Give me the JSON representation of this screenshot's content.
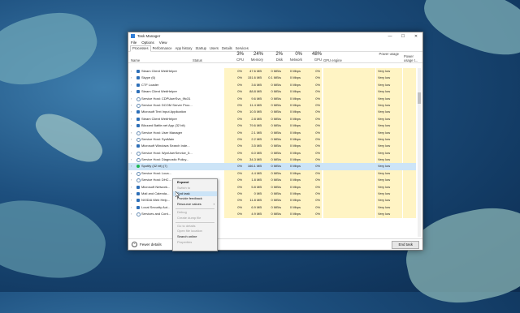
{
  "window": {
    "title": "Task Manager",
    "controls": [
      "—",
      "☐",
      "✕"
    ]
  },
  "menu": [
    "File",
    "Options",
    "View"
  ],
  "tabs": [
    "Processes",
    "Performance",
    "App history",
    "Startup",
    "Users",
    "Details",
    "Services"
  ],
  "columns": {
    "name": "Name",
    "status": "Status",
    "cpu": {
      "pct": "3%",
      "label": "CPU"
    },
    "memory": {
      "pct": "24%",
      "label": "Memory"
    },
    "disk": {
      "pct": "2%",
      "label": "Disk"
    },
    "network": {
      "pct": "0%",
      "label": "Network"
    },
    "gpu": {
      "pct": "48%",
      "label": "GPU"
    },
    "gpu_engine": "GPU engine",
    "power": "Power usage",
    "power_trend": "Power usage t..."
  },
  "rows": [
    {
      "name": "Steam Client WebHelper",
      "icon": "steam-icon",
      "cpu": "0%",
      "mem": "47.6 MB",
      "disk": "0 MB/s",
      "net": "0 Mbps",
      "gpu": "0%",
      "power": "Very low"
    },
    {
      "name": "Skype (6)",
      "icon": "skype-icon",
      "cpu": "0%",
      "mem": "151.6 MB",
      "disk": "0.1 MB/s",
      "net": "0 Mbps",
      "gpu": "0%",
      "power": "Very low"
    },
    {
      "name": "CTF Loader",
      "icon": "ctf-icon",
      "cpu": "0%",
      "mem": "3.6 MB",
      "disk": "0 MB/s",
      "net": "0 Mbps",
      "gpu": "0%",
      "power": "Very low"
    },
    {
      "name": "Steam Client WebHelper",
      "icon": "steam-icon",
      "cpu": "0%",
      "mem": "88.8 MB",
      "disk": "0 MB/s",
      "net": "0 Mbps",
      "gpu": "0%",
      "power": "Very low"
    },
    {
      "name": "Service Host: CDPUserSvc_9fc31",
      "icon": "service-gear-icon",
      "cpu": "0%",
      "mem": "9.6 MB",
      "disk": "0 MB/s",
      "net": "0 Mbps",
      "gpu": "0%",
      "power": "Very low"
    },
    {
      "name": "Service Host: DCOM Server Proc...",
      "icon": "service-gear-icon",
      "cpu": "0%",
      "mem": "11.4 MB",
      "disk": "0 MB/s",
      "net": "0 Mbps",
      "gpu": "0%",
      "power": "Very low"
    },
    {
      "name": "Microsoft Text Input Application",
      "icon": "app-icon",
      "cpu": "0%",
      "mem": "10.5 MB",
      "disk": "0 MB/s",
      "net": "0 Mbps",
      "gpu": "0%",
      "power": "Very low"
    },
    {
      "name": "Steam Client WebHelper",
      "icon": "steam-icon",
      "cpu": "0%",
      "mem": "2.8 MB",
      "disk": "0 MB/s",
      "net": "0 Mbps",
      "gpu": "0%",
      "power": "Very low"
    },
    {
      "name": "Blizzard Battle.net App (32 bit)",
      "icon": "battlenet-icon",
      "cpu": "0%",
      "mem": "79.6 MB",
      "disk": "0 MB/s",
      "net": "0 Mbps",
      "gpu": "0%",
      "power": "Very low"
    },
    {
      "name": "Service Host: User Manager",
      "icon": "service-gear-icon",
      "cpu": "0%",
      "mem": "2.1 MB",
      "disk": "0 MB/s",
      "net": "0 Mbps",
      "gpu": "0%",
      "power": "Very low"
    },
    {
      "name": "Service Host: SysMain",
      "icon": "service-gear-icon",
      "cpu": "0%",
      "mem": "2.2 MB",
      "disk": "0 MB/s",
      "net": "0 Mbps",
      "gpu": "0%",
      "power": "Very low"
    },
    {
      "name": "Microsoft Windows Search Inde...",
      "icon": "search-indexer-icon",
      "cpu": "0%",
      "mem": "3.5 MB",
      "disk": "0 MB/s",
      "net": "0 Mbps",
      "gpu": "0%",
      "power": "Very low"
    },
    {
      "name": "Service Host: WpnUserService_5...",
      "icon": "service-gear-icon",
      "cpu": "0%",
      "mem": "6.0 MB",
      "disk": "0 MB/s",
      "net": "0 Mbps",
      "gpu": "0%",
      "power": "Very low"
    },
    {
      "name": "Service Host: Diagnostic Policy...",
      "icon": "service-gear-icon",
      "cpu": "0%",
      "mem": "34.3 MB",
      "disk": "0 MB/s",
      "net": "0 Mbps",
      "gpu": "0%",
      "power": "Very low"
    },
    {
      "name": "Spotify (32 bit) (7)",
      "icon": "spotify-icon",
      "cpu": "0%",
      "mem": "166.1 MB",
      "disk": "0 MB/s",
      "net": "0 Mbps",
      "gpu": "0%",
      "power": "Very low",
      "selected": true
    },
    {
      "name": "Service Host: Loca...",
      "icon": "service-gear-icon",
      "cpu": "0%",
      "mem": "4.4 MB",
      "disk": "0 MB/s",
      "net": "0 Mbps",
      "gpu": "0%",
      "power": "Very low"
    },
    {
      "name": "Service Host: DHC...",
      "icon": "service-gear-icon",
      "cpu": "0%",
      "mem": "1.8 MB",
      "disk": "0 MB/s",
      "net": "0 Mbps",
      "gpu": "0%",
      "power": "Very low"
    },
    {
      "name": "Microsoft Network...",
      "icon": "app-icon",
      "cpu": "0%",
      "mem": "5.8 MB",
      "disk": "0 MB/s",
      "net": "0 Mbps",
      "gpu": "0%",
      "power": "Very low"
    },
    {
      "name": "Mail and Calenda...",
      "icon": "mail-icon",
      "cpu": "0%",
      "mem": "0 MB",
      "disk": "0 MB/s",
      "net": "0 Mbps",
      "gpu": "0%",
      "power": "Very low"
    },
    {
      "name": "NVIDIA Web Help...",
      "icon": "nvidia-icon",
      "cpu": "0%",
      "mem": "11.8 MB",
      "disk": "0 MB/s",
      "net": "0 Mbps",
      "gpu": "0%",
      "power": "Very low"
    },
    {
      "name": "Local Security Aut...",
      "icon": "security-icon",
      "cpu": "0%",
      "mem": "6.9 MB",
      "disk": "0 MB/s",
      "net": "0 Mbps",
      "gpu": "0%",
      "power": "Very low"
    },
    {
      "name": "Services and Cont...",
      "icon": "service-gear-icon",
      "cpu": "0%",
      "mem": "4.9 MB",
      "disk": "0 MB/s",
      "net": "0 Mbps",
      "gpu": "0%",
      "power": "Very low"
    }
  ],
  "context_menu": [
    {
      "label": "Expand",
      "bold": true
    },
    {
      "label": "Switch to",
      "disabled": true
    },
    {
      "label": "End task",
      "highlight": true
    },
    {
      "label": "Provide feedback"
    },
    {
      "label": "Resource values",
      "submenu": true
    },
    {
      "label": "Debug",
      "disabled": true,
      "sep_before": true
    },
    {
      "label": "Create dump file",
      "disabled": true
    },
    {
      "label": "Go to details",
      "disabled": true,
      "sep_before": true
    },
    {
      "label": "Open file location",
      "disabled": true
    },
    {
      "label": "Search online"
    },
    {
      "label": "Properties",
      "disabled": true
    }
  ],
  "footer": {
    "fewer_details": "Fewer details",
    "end_task": "End task"
  },
  "colors": {
    "accent": "#cce4f7",
    "heat": "#fff4c4"
  }
}
